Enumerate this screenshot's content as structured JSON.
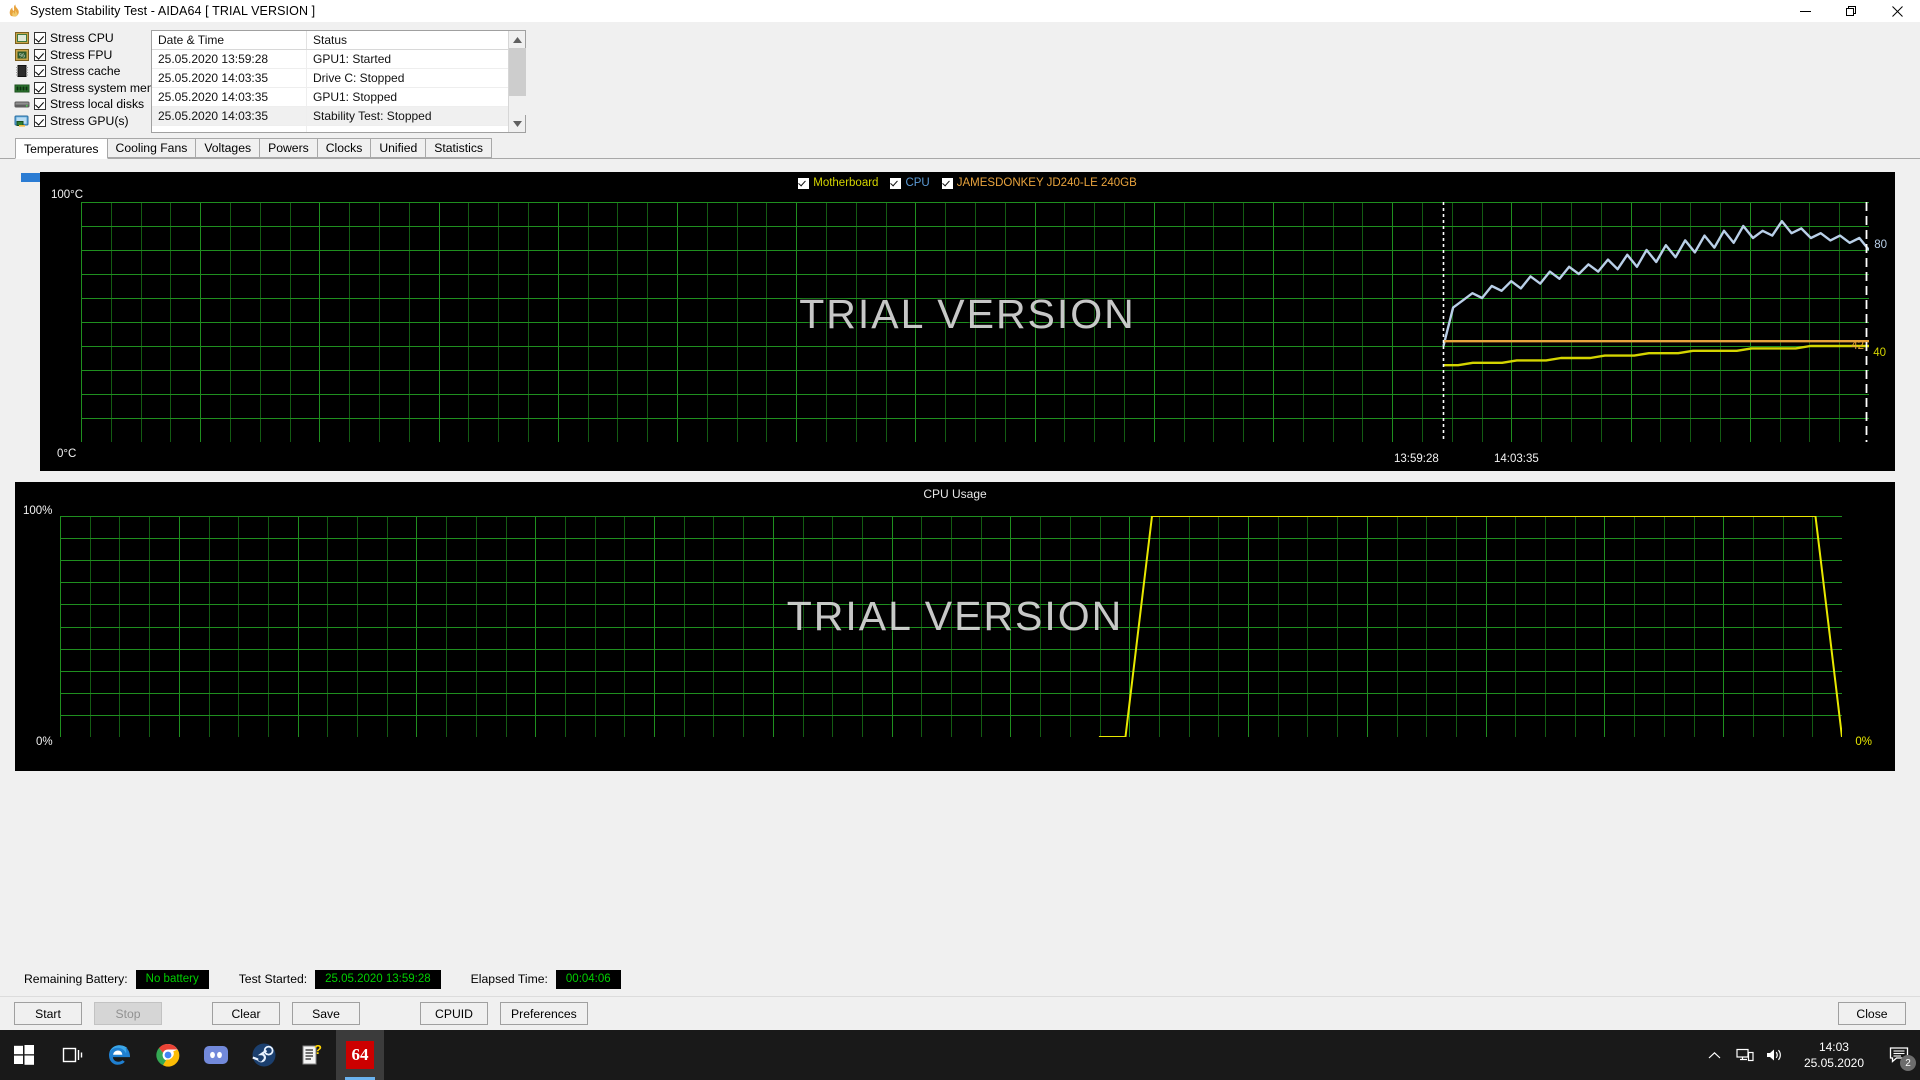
{
  "window": {
    "title": "System Stability Test - AIDA64  [ TRIAL VERSION ]",
    "icon": "aida64-flame-icon",
    "minimize_label": "─",
    "maximize_label": "❐",
    "close_label": "✕"
  },
  "stress_options": [
    {
      "label": "Stress CPU",
      "icon": "cpu-chip-icon",
      "checked": true
    },
    {
      "label": "Stress FPU",
      "icon": "fpu-percent-icon",
      "checked": true
    },
    {
      "label": "Stress cache",
      "icon": "cache-chip-icon",
      "checked": true
    },
    {
      "label": "Stress system memory",
      "icon": "memory-ram-icon",
      "checked": true
    },
    {
      "label": "Stress local disks",
      "icon": "hard-disk-icon",
      "checked": true
    },
    {
      "label": "Stress GPU(s)",
      "icon": "gpu-monitor-icon",
      "checked": true
    }
  ],
  "log": {
    "columns": [
      "Date & Time",
      "Status"
    ],
    "rows": [
      {
        "datetime": "25.05.2020 13:59:28",
        "status": "GPU1: Started",
        "selected": false
      },
      {
        "datetime": "25.05.2020 14:03:35",
        "status": "Drive C: Stopped",
        "selected": false
      },
      {
        "datetime": "25.05.2020 14:03:35",
        "status": "GPU1: Stopped",
        "selected": false
      },
      {
        "datetime": "25.05.2020 14:03:35",
        "status": "Stability Test: Stopped",
        "selected": true
      }
    ]
  },
  "tabs": [
    {
      "label": "Temperatures",
      "active": true
    },
    {
      "label": "Cooling Fans",
      "active": false
    },
    {
      "label": "Voltages",
      "active": false
    },
    {
      "label": "Powers",
      "active": false
    },
    {
      "label": "Clocks",
      "active": false
    },
    {
      "label": "Unified",
      "active": false
    },
    {
      "label": "Statistics",
      "active": false
    }
  ],
  "watermark": "TRIAL VERSION",
  "chart_data": [
    {
      "type": "line",
      "name": "temperatures-chart",
      "title": "",
      "ylabel": "",
      "xlabel": "",
      "ytick_top": "100°C",
      "ytick_bottom": "0°C",
      "ylim": [
        0,
        100
      ],
      "grid": true,
      "legend_position": "top-center",
      "xticks": [
        "13:59:28",
        "14:03:35"
      ],
      "series": [
        {
          "name": "Motherboard",
          "color": "#d4d400",
          "end_value": 40,
          "end_label": "40",
          "values": [
            32,
            32,
            33,
            33,
            33,
            34,
            34,
            34,
            35,
            35,
            35,
            36,
            36,
            36,
            37,
            37,
            37,
            38,
            38,
            38,
            38,
            39,
            39,
            39,
            39,
            40,
            40,
            40,
            40,
            40
          ]
        },
        {
          "name": "CPU",
          "color": "#b9cfe8",
          "end_value": 80,
          "end_label": "80",
          "values": [
            40,
            56,
            59,
            62,
            60,
            65,
            63,
            67,
            64,
            69,
            66,
            71,
            68,
            73,
            70,
            74,
            71,
            76,
            72,
            78,
            73,
            80,
            75,
            82,
            77,
            84,
            79,
            86,
            81,
            88,
            83,
            90,
            85,
            88,
            86,
            92,
            87,
            89,
            85,
            87,
            84,
            86,
            83,
            85,
            80
          ]
        },
        {
          "name": "JAMESDONKEY JD240-LE 240GB",
          "color": "#e8a33d",
          "end_value": 42,
          "end_label": "42",
          "values": [
            42,
            42,
            42,
            42,
            42,
            42,
            42,
            42,
            42,
            42,
            42,
            42,
            42,
            42,
            42,
            42,
            42,
            42,
            42,
            42,
            42,
            42,
            42,
            42,
            42,
            42,
            42,
            42,
            42,
            42
          ]
        }
      ],
      "legend": [
        {
          "label": "Motherboard",
          "color": "#d4d400",
          "checked": true
        },
        {
          "label": "CPU",
          "color": "#5c9bd6",
          "checked": true
        },
        {
          "label": "JAMESDONKEY JD240-LE 240GB",
          "color": "#e8a33d",
          "checked": true
        }
      ]
    },
    {
      "type": "line",
      "name": "cpu-usage-chart",
      "title": "CPU Usage",
      "ytick_top": "100%",
      "ytick_bottom": "0%",
      "ylim": [
        0,
        100
      ],
      "grid": true,
      "series": [
        {
          "name": "CPU Usage",
          "color": "#e8e800",
          "end_value": 0,
          "end_label": "0%",
          "values": [
            0,
            0,
            100,
            100,
            100,
            100,
            100,
            100,
            100,
            100,
            100,
            100,
            100,
            100,
            100,
            100,
            100,
            100,
            100,
            100,
            100,
            100,
            100,
            100,
            100,
            100,
            100,
            100,
            0
          ]
        }
      ]
    }
  ],
  "status": {
    "battery_label": "Remaining Battery:",
    "battery_value": "No battery",
    "started_label": "Test Started:",
    "started_value": "25.05.2020 13:59:28",
    "elapsed_label": "Elapsed Time:",
    "elapsed_value": "00:04:06"
  },
  "buttons": {
    "start": "Start",
    "stop": "Stop",
    "clear": "Clear",
    "save": "Save",
    "cpuid": "CPUID",
    "preferences": "Preferences",
    "close": "Close"
  },
  "taskbar": {
    "items": [
      {
        "icon": "windows-start-icon",
        "active": false,
        "running": false
      },
      {
        "icon": "task-view-icon",
        "active": false,
        "running": false
      },
      {
        "icon": "edge-browser-icon",
        "active": false,
        "running": true
      },
      {
        "icon": "chrome-browser-icon",
        "active": false,
        "running": true
      },
      {
        "icon": "discord-icon",
        "active": false,
        "running": false
      },
      {
        "icon": "steam-icon",
        "active": false,
        "running": false
      },
      {
        "icon": "help-document-icon",
        "active": false,
        "running": true
      },
      {
        "icon": "aida64-icon",
        "label": "64",
        "active": true,
        "running": true
      }
    ],
    "tray": [
      {
        "icon": "chevron-up-icon"
      },
      {
        "icon": "network-icon"
      },
      {
        "icon": "volume-icon"
      }
    ],
    "clock_time": "14:03",
    "clock_date": "25.05.2020",
    "notification_count": "2"
  }
}
